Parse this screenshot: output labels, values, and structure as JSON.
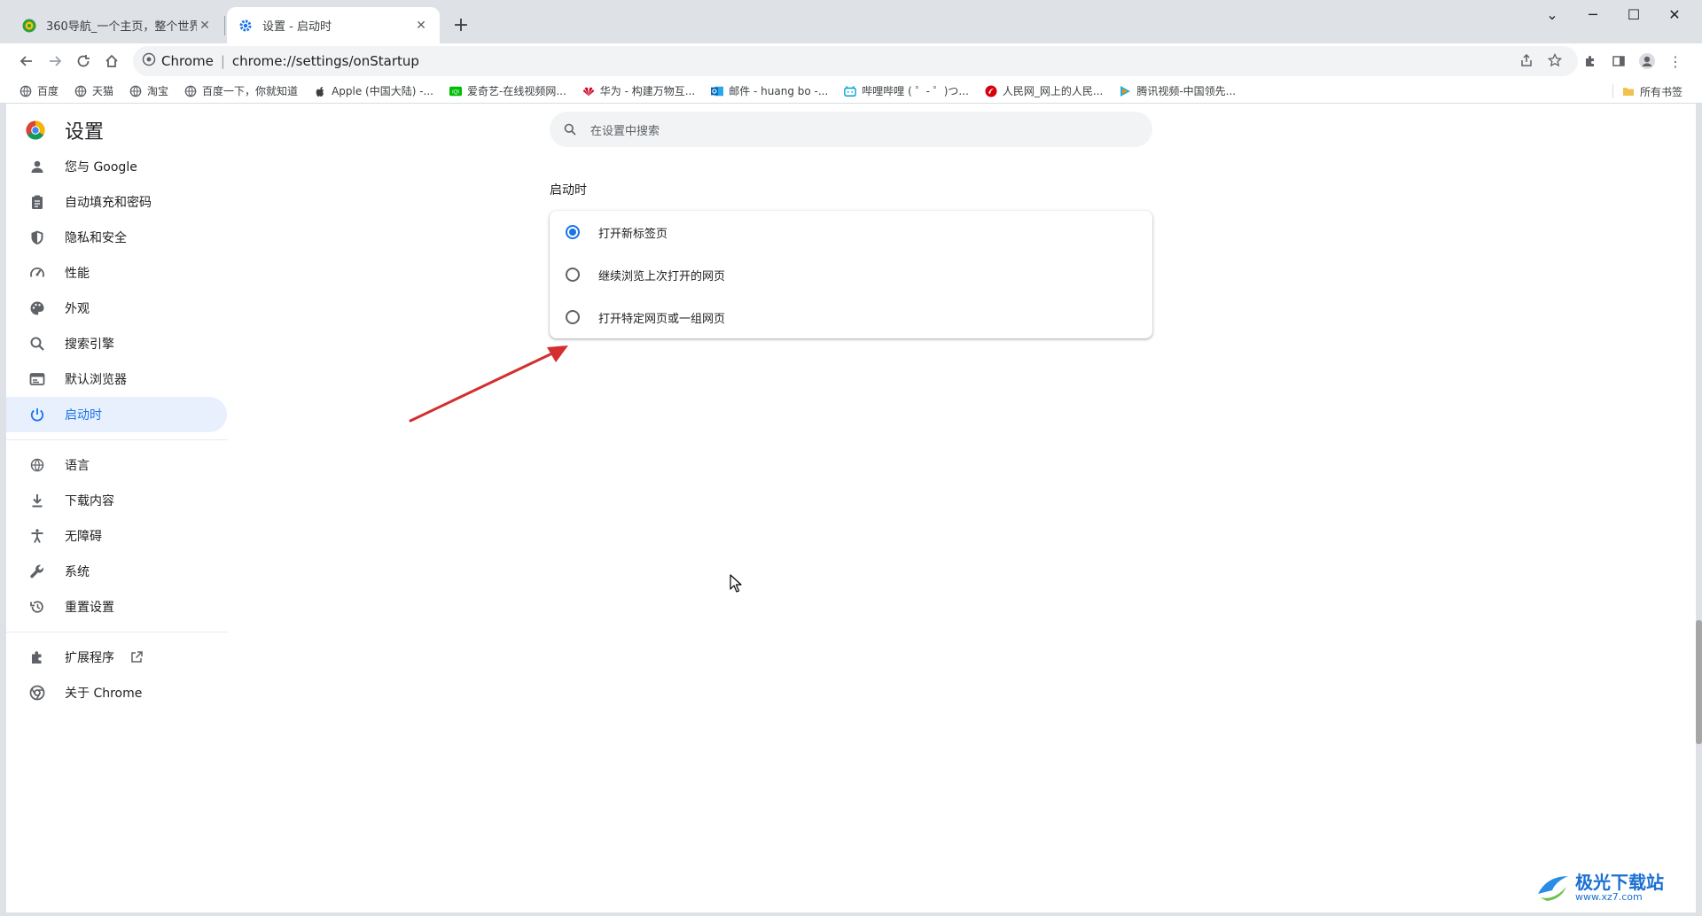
{
  "tabs": [
    {
      "title": "360导航_一个主页，整个世界",
      "active": false,
      "favicon": "360-icon"
    },
    {
      "title": "设置 - 启动时",
      "active": true,
      "favicon": "gear-icon"
    }
  ],
  "new_tab_label": "+",
  "window_controls": {
    "dropdown": "⌄",
    "minimize": "─",
    "maximize": "☐",
    "close": "✕"
  },
  "omnibox": {
    "site_label": "Chrome",
    "divider": "|",
    "url": "chrome://settings/onStartup"
  },
  "bookmarks": [
    {
      "label": "百度",
      "icon": "globe-icon"
    },
    {
      "label": "天猫",
      "icon": "globe-icon"
    },
    {
      "label": "淘宝",
      "icon": "globe-icon"
    },
    {
      "label": "百度一下，你就知道",
      "icon": "globe-icon"
    },
    {
      "label": "Apple (中国大陆) -...",
      "icon": "apple-icon"
    },
    {
      "label": "爱奇艺-在线视频网...",
      "icon": "iqiyi-icon"
    },
    {
      "label": "华为 - 构建万物互...",
      "icon": "huawei-icon"
    },
    {
      "label": "邮件 - huang bo -...",
      "icon": "outlook-icon"
    },
    {
      "label": "哔哩哔哩 ( ゜- ゜)つ...",
      "icon": "bilibili-icon"
    },
    {
      "label": "人民网_网上的人民...",
      "icon": "people-icon"
    },
    {
      "label": "腾讯视频-中国领先...",
      "icon": "tencent-video-icon"
    }
  ],
  "all_bookmarks_label": "所有书签",
  "settings": {
    "title": "设置",
    "search_placeholder": "在设置中搜索",
    "nav_group1": [
      {
        "label": "您与 Google",
        "icon": "person-icon"
      },
      {
        "label": "自动填充和密码",
        "icon": "clipboard-icon"
      },
      {
        "label": "隐私和安全",
        "icon": "shield-icon"
      },
      {
        "label": "性能",
        "icon": "speedometer-icon"
      },
      {
        "label": "外观",
        "icon": "palette-icon"
      },
      {
        "label": "搜索引擎",
        "icon": "search-icon"
      },
      {
        "label": "默认浏览器",
        "icon": "browser-icon"
      },
      {
        "label": "启动时",
        "icon": "power-icon",
        "selected": true
      }
    ],
    "nav_group2": [
      {
        "label": "语言",
        "icon": "globe-icon"
      },
      {
        "label": "下载内容",
        "icon": "download-icon"
      },
      {
        "label": "无障碍",
        "icon": "accessibility-icon"
      },
      {
        "label": "系统",
        "icon": "wrench-icon"
      },
      {
        "label": "重置设置",
        "icon": "history-icon"
      }
    ],
    "nav_group3": [
      {
        "label": "扩展程序",
        "icon": "puzzle-icon",
        "external": true
      },
      {
        "label": "关于 Chrome",
        "icon": "chrome-icon"
      }
    ],
    "section_title": "启动时",
    "options": [
      {
        "label": "打开新标签页",
        "checked": true
      },
      {
        "label": "继续浏览上次打开的网页",
        "checked": false
      },
      {
        "label": "打开特定网页或一组网页",
        "checked": false
      }
    ]
  },
  "watermark": {
    "title": "极光下载站",
    "url": "www.xz7.com"
  },
  "colors": {
    "accent": "#1a73e8",
    "selected_bg": "#e8f0fe",
    "arrow": "#d32f2f"
  }
}
